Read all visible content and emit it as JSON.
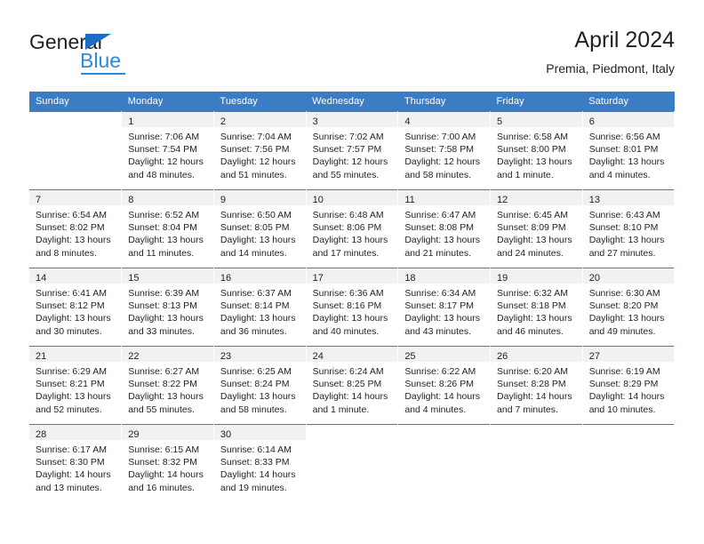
{
  "logo": {
    "word_one": "General",
    "word_two": "Blue",
    "triangle_icon": "triangle-icon",
    "brand_color": "#2b8ad6"
  },
  "header": {
    "title": "April 2024",
    "subtitle": "Premia, Piedmont, Italy",
    "header_bg_color": "#3b7dc4",
    "daynum_band_color": "#f1f1f1"
  },
  "weekday_headers": [
    "Sunday",
    "Monday",
    "Tuesday",
    "Wednesday",
    "Thursday",
    "Friday",
    "Saturday"
  ],
  "weeks": [
    {
      "days": [
        {
          "daynum": "",
          "empty": true,
          "sunrise": "",
          "sunset": "",
          "daylight_1": "",
          "daylight_2": ""
        },
        {
          "daynum": "1",
          "empty": false,
          "sunrise": "Sunrise: 7:06 AM",
          "sunset": "Sunset: 7:54 PM",
          "daylight_1": "Daylight: 12 hours",
          "daylight_2": "and 48 minutes."
        },
        {
          "daynum": "2",
          "empty": false,
          "sunrise": "Sunrise: 7:04 AM",
          "sunset": "Sunset: 7:56 PM",
          "daylight_1": "Daylight: 12 hours",
          "daylight_2": "and 51 minutes."
        },
        {
          "daynum": "3",
          "empty": false,
          "sunrise": "Sunrise: 7:02 AM",
          "sunset": "Sunset: 7:57 PM",
          "daylight_1": "Daylight: 12 hours",
          "daylight_2": "and 55 minutes."
        },
        {
          "daynum": "4",
          "empty": false,
          "sunrise": "Sunrise: 7:00 AM",
          "sunset": "Sunset: 7:58 PM",
          "daylight_1": "Daylight: 12 hours",
          "daylight_2": "and 58 minutes."
        },
        {
          "daynum": "5",
          "empty": false,
          "sunrise": "Sunrise: 6:58 AM",
          "sunset": "Sunset: 8:00 PM",
          "daylight_1": "Daylight: 13 hours",
          "daylight_2": "and 1 minute."
        },
        {
          "daynum": "6",
          "empty": false,
          "sunrise": "Sunrise: 6:56 AM",
          "sunset": "Sunset: 8:01 PM",
          "daylight_1": "Daylight: 13 hours",
          "daylight_2": "and 4 minutes."
        }
      ]
    },
    {
      "days": [
        {
          "daynum": "7",
          "empty": false,
          "sunrise": "Sunrise: 6:54 AM",
          "sunset": "Sunset: 8:02 PM",
          "daylight_1": "Daylight: 13 hours",
          "daylight_2": "and 8 minutes."
        },
        {
          "daynum": "8",
          "empty": false,
          "sunrise": "Sunrise: 6:52 AM",
          "sunset": "Sunset: 8:04 PM",
          "daylight_1": "Daylight: 13 hours",
          "daylight_2": "and 11 minutes."
        },
        {
          "daynum": "9",
          "empty": false,
          "sunrise": "Sunrise: 6:50 AM",
          "sunset": "Sunset: 8:05 PM",
          "daylight_1": "Daylight: 13 hours",
          "daylight_2": "and 14 minutes."
        },
        {
          "daynum": "10",
          "empty": false,
          "sunrise": "Sunrise: 6:48 AM",
          "sunset": "Sunset: 8:06 PM",
          "daylight_1": "Daylight: 13 hours",
          "daylight_2": "and 17 minutes."
        },
        {
          "daynum": "11",
          "empty": false,
          "sunrise": "Sunrise: 6:47 AM",
          "sunset": "Sunset: 8:08 PM",
          "daylight_1": "Daylight: 13 hours",
          "daylight_2": "and 21 minutes."
        },
        {
          "daynum": "12",
          "empty": false,
          "sunrise": "Sunrise: 6:45 AM",
          "sunset": "Sunset: 8:09 PM",
          "daylight_1": "Daylight: 13 hours",
          "daylight_2": "and 24 minutes."
        },
        {
          "daynum": "13",
          "empty": false,
          "sunrise": "Sunrise: 6:43 AM",
          "sunset": "Sunset: 8:10 PM",
          "daylight_1": "Daylight: 13 hours",
          "daylight_2": "and 27 minutes."
        }
      ]
    },
    {
      "days": [
        {
          "daynum": "14",
          "empty": false,
          "sunrise": "Sunrise: 6:41 AM",
          "sunset": "Sunset: 8:12 PM",
          "daylight_1": "Daylight: 13 hours",
          "daylight_2": "and 30 minutes."
        },
        {
          "daynum": "15",
          "empty": false,
          "sunrise": "Sunrise: 6:39 AM",
          "sunset": "Sunset: 8:13 PM",
          "daylight_1": "Daylight: 13 hours",
          "daylight_2": "and 33 minutes."
        },
        {
          "daynum": "16",
          "empty": false,
          "sunrise": "Sunrise: 6:37 AM",
          "sunset": "Sunset: 8:14 PM",
          "daylight_1": "Daylight: 13 hours",
          "daylight_2": "and 36 minutes."
        },
        {
          "daynum": "17",
          "empty": false,
          "sunrise": "Sunrise: 6:36 AM",
          "sunset": "Sunset: 8:16 PM",
          "daylight_1": "Daylight: 13 hours",
          "daylight_2": "and 40 minutes."
        },
        {
          "daynum": "18",
          "empty": false,
          "sunrise": "Sunrise: 6:34 AM",
          "sunset": "Sunset: 8:17 PM",
          "daylight_1": "Daylight: 13 hours",
          "daylight_2": "and 43 minutes."
        },
        {
          "daynum": "19",
          "empty": false,
          "sunrise": "Sunrise: 6:32 AM",
          "sunset": "Sunset: 8:18 PM",
          "daylight_1": "Daylight: 13 hours",
          "daylight_2": "and 46 minutes."
        },
        {
          "daynum": "20",
          "empty": false,
          "sunrise": "Sunrise: 6:30 AM",
          "sunset": "Sunset: 8:20 PM",
          "daylight_1": "Daylight: 13 hours",
          "daylight_2": "and 49 minutes."
        }
      ]
    },
    {
      "days": [
        {
          "daynum": "21",
          "empty": false,
          "sunrise": "Sunrise: 6:29 AM",
          "sunset": "Sunset: 8:21 PM",
          "daylight_1": "Daylight: 13 hours",
          "daylight_2": "and 52 minutes."
        },
        {
          "daynum": "22",
          "empty": false,
          "sunrise": "Sunrise: 6:27 AM",
          "sunset": "Sunset: 8:22 PM",
          "daylight_1": "Daylight: 13 hours",
          "daylight_2": "and 55 minutes."
        },
        {
          "daynum": "23",
          "empty": false,
          "sunrise": "Sunrise: 6:25 AM",
          "sunset": "Sunset: 8:24 PM",
          "daylight_1": "Daylight: 13 hours",
          "daylight_2": "and 58 minutes."
        },
        {
          "daynum": "24",
          "empty": false,
          "sunrise": "Sunrise: 6:24 AM",
          "sunset": "Sunset: 8:25 PM",
          "daylight_1": "Daylight: 14 hours",
          "daylight_2": "and 1 minute."
        },
        {
          "daynum": "25",
          "empty": false,
          "sunrise": "Sunrise: 6:22 AM",
          "sunset": "Sunset: 8:26 PM",
          "daylight_1": "Daylight: 14 hours",
          "daylight_2": "and 4 minutes."
        },
        {
          "daynum": "26",
          "empty": false,
          "sunrise": "Sunrise: 6:20 AM",
          "sunset": "Sunset: 8:28 PM",
          "daylight_1": "Daylight: 14 hours",
          "daylight_2": "and 7 minutes."
        },
        {
          "daynum": "27",
          "empty": false,
          "sunrise": "Sunrise: 6:19 AM",
          "sunset": "Sunset: 8:29 PM",
          "daylight_1": "Daylight: 14 hours",
          "daylight_2": "and 10 minutes."
        }
      ]
    },
    {
      "days": [
        {
          "daynum": "28",
          "empty": false,
          "sunrise": "Sunrise: 6:17 AM",
          "sunset": "Sunset: 8:30 PM",
          "daylight_1": "Daylight: 14 hours",
          "daylight_2": "and 13 minutes."
        },
        {
          "daynum": "29",
          "empty": false,
          "sunrise": "Sunrise: 6:15 AM",
          "sunset": "Sunset: 8:32 PM",
          "daylight_1": "Daylight: 14 hours",
          "daylight_2": "and 16 minutes."
        },
        {
          "daynum": "30",
          "empty": false,
          "sunrise": "Sunrise: 6:14 AM",
          "sunset": "Sunset: 8:33 PM",
          "daylight_1": "Daylight: 14 hours",
          "daylight_2": "and 19 minutes."
        },
        {
          "daynum": "",
          "empty": true,
          "sunrise": "",
          "sunset": "",
          "daylight_1": "",
          "daylight_2": ""
        },
        {
          "daynum": "",
          "empty": true,
          "sunrise": "",
          "sunset": "",
          "daylight_1": "",
          "daylight_2": ""
        },
        {
          "daynum": "",
          "empty": true,
          "sunrise": "",
          "sunset": "",
          "daylight_1": "",
          "daylight_2": ""
        },
        {
          "daynum": "",
          "empty": true,
          "sunrise": "",
          "sunset": "",
          "daylight_1": "",
          "daylight_2": ""
        }
      ]
    }
  ]
}
